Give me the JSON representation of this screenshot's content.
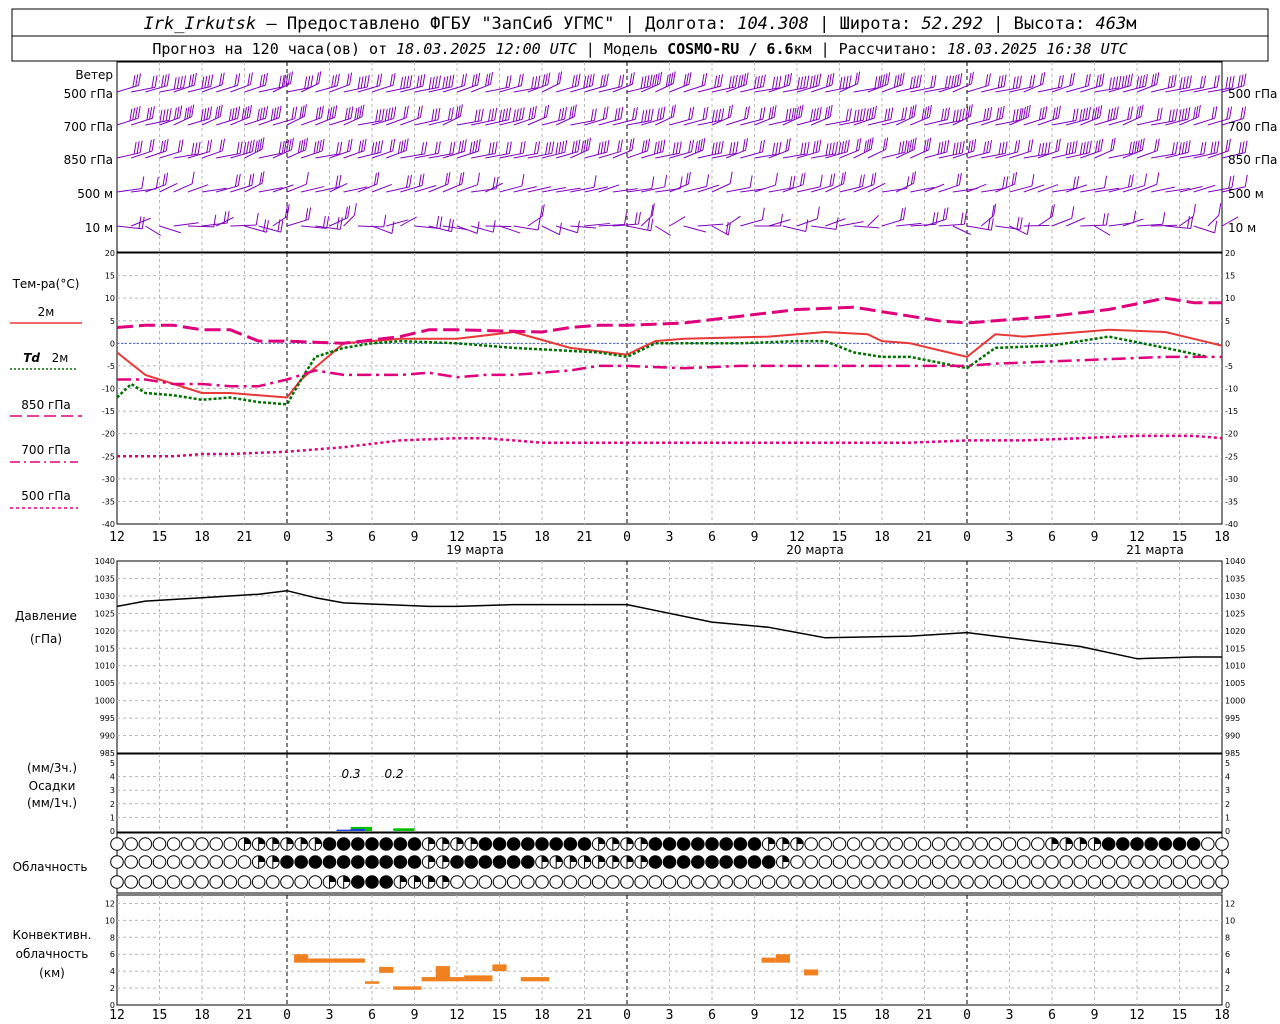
{
  "header": {
    "station": "Irk_Irkutsk",
    "provider": " — Предоставлено ФГБУ \"ЗапСиб УГМС\" | Долгота: ",
    "lon": "104.308",
    "lat_label": " | Широта: ",
    "lat": "52.292",
    "alt_label": " | Высота: ",
    "alt": "463",
    "alt_unit": "м",
    "forecast_label": "Прогноз на 120 часа(ов) от ",
    "forecast_date": "18.03.2025 12:00 UTC",
    "model_label": " | Модель ",
    "model": "COSMO-RU / 6.6",
    "model_unit": "км",
    "calc_label": " | Рассчитано: ",
    "calc_date": "18.03.2025 16:38 UTC"
  },
  "labels": {
    "wind": "Ветер",
    "levels": [
      "500 гПа",
      "700 гПа",
      "850 гПа",
      "500 м",
      "10  м"
    ],
    "temp_title": "Тем-ра(°C)",
    "t2m": "2м",
    "td": "Td",
    "td2": "2м",
    "t850": "850 гПа",
    "t700": "700 гПа",
    "t500": "500 гПа",
    "pressure": "Давление",
    "pressure_unit": "(гПа)",
    "precip_3h": "(мм/3ч.)",
    "precip": "Осадки",
    "precip_1h": "(мм/1ч.)",
    "cloud": "Облачность",
    "conv1": "Конвективн.",
    "conv2": "облачность",
    "conv3": "(км)",
    "days": [
      "19 марта",
      "20 марта",
      "21 марта"
    ],
    "precip_annot": [
      "0.3",
      "0.2"
    ]
  },
  "colors": {
    "wind": "#8000c0",
    "t2m": "#e83838",
    "td": "#007000",
    "t850": "#e0007c",
    "t700": "#e0007c",
    "t500": "#e0007c",
    "pressure": "#000000",
    "precip_3h": "#00c000",
    "precip_1h": "#2040e0",
    "conv": "#f08020"
  },
  "chart_data": {
    "type": "line",
    "x_ticks": [
      "12",
      "15",
      "18",
      "21",
      "0",
      "3",
      "6",
      "9",
      "12",
      "15",
      "18",
      "21",
      "0",
      "3",
      "6",
      "9",
      "12",
      "15",
      "18",
      "21",
      "0",
      "3",
      "6",
      "9",
      "12",
      "15",
      "18"
    ],
    "x_range": [
      0,
      78
    ],
    "day_boundaries": [
      12,
      36,
      60
    ],
    "wind_levels": [
      "500 гПа",
      "700 гПа",
      "850 гПа",
      "500 м",
      "10 м"
    ],
    "temperature": {
      "ylim": [
        -40,
        20
      ],
      "yticks": [
        -40,
        -35,
        -30,
        -25,
        -20,
        -15,
        -10,
        -5,
        0,
        5,
        10,
        15,
        20
      ],
      "series": [
        {
          "name": "2м",
          "x": [
            0,
            2,
            3,
            6,
            8,
            12,
            13,
            16,
            20,
            24,
            28,
            32,
            36,
            38,
            40,
            46,
            50,
            53,
            54,
            56,
            60,
            62,
            64,
            70,
            74,
            76,
            78
          ],
          "values": [
            -2,
            -7,
            -8,
            -11,
            -11,
            -12,
            -8,
            0,
            1,
            1,
            2.5,
            -1,
            -2.5,
            0.5,
            1,
            1.5,
            2.5,
            2,
            0.5,
            0,
            -3,
            2,
            1.5,
            3,
            2.5,
            1,
            -0.5
          ]
        },
        {
          "name": "Td 2м",
          "x": [
            0,
            1,
            2,
            4,
            6,
            8,
            10,
            12,
            13,
            14,
            16,
            18,
            20,
            24,
            28,
            34,
            36,
            38,
            44,
            48,
            50,
            52,
            54,
            56,
            60,
            62,
            66,
            70,
            74,
            77
          ],
          "values": [
            -12,
            -9,
            -11,
            -11.5,
            -12.5,
            -12,
            -13,
            -13.5,
            -8,
            -3,
            -1,
            0,
            0.5,
            0,
            -1,
            -2,
            -3,
            0,
            0,
            0.5,
            0.5,
            -2,
            -3,
            -3,
            -5.5,
            -1,
            -0.5,
            1.5,
            -1,
            -3
          ]
        },
        {
          "name": "850 гПа",
          "x": [
            0,
            2,
            4,
            6,
            8,
            10,
            12,
            16,
            20,
            22,
            24,
            30,
            32,
            34,
            36,
            40,
            44,
            48,
            52,
            56,
            58,
            60,
            62,
            66,
            70,
            74,
            76,
            78
          ],
          "values": [
            3.5,
            4,
            4,
            3,
            3,
            0.5,
            0.5,
            0,
            1.5,
            3,
            3,
            2.5,
            3.5,
            4,
            4,
            4.5,
            6,
            7.5,
            8,
            6,
            5,
            4.5,
            5,
            6,
            7.5,
            10,
            9,
            9
          ]
        },
        {
          "name": "700 гПа",
          "x": [
            0,
            2,
            4,
            6,
            8,
            10,
            12,
            14,
            16,
            18,
            20,
            22,
            24,
            26,
            28,
            30,
            32,
            34,
            36,
            40,
            44,
            48,
            52,
            56,
            58,
            60,
            62,
            66,
            70,
            74,
            78
          ],
          "values": [
            -8,
            -8,
            -9,
            -9,
            -9.5,
            -9.5,
            -8,
            -6,
            -7,
            -7,
            -7,
            -6.5,
            -7.5,
            -7,
            -7,
            -6.5,
            -6,
            -5,
            -5,
            -5.5,
            -5,
            -5,
            -5,
            -5,
            -5,
            -5,
            -4.5,
            -4,
            -3.5,
            -3,
            -3
          ]
        },
        {
          "name": "500 гПа",
          "x": [
            0,
            4,
            6,
            8,
            12,
            16,
            20,
            24,
            26,
            28,
            30,
            32,
            36,
            40,
            44,
            48,
            52,
            56,
            60,
            64,
            68,
            72,
            76,
            78
          ],
          "values": [
            -25,
            -25,
            -24.5,
            -24.5,
            -24,
            -23,
            -21.5,
            -21,
            -21,
            -21.5,
            -22,
            -22,
            -22,
            -22,
            -22,
            -22,
            -22,
            -22,
            -21.5,
            -21.5,
            -21,
            -20.5,
            -20.5,
            -21
          ]
        }
      ]
    },
    "pressure": {
      "ylim": [
        985,
        1040
      ],
      "yticks": [
        985,
        990,
        995,
        1000,
        1005,
        1010,
        1015,
        1020,
        1025,
        1030,
        1035,
        1040
      ],
      "x": [
        0,
        2,
        6,
        10,
        12,
        14,
        16,
        22,
        24,
        28,
        36,
        42,
        46,
        50,
        56,
        60,
        62,
        68,
        72,
        76,
        78
      ],
      "values": [
        1027,
        1028.5,
        1029.5,
        1030.5,
        1031.5,
        1029.5,
        1028,
        1027,
        1027,
        1027.5,
        1027.5,
        1022.5,
        1021,
        1018,
        1018.5,
        1019.5,
        1018.5,
        1015.5,
        1012,
        1012.5,
        1012.5
      ]
    },
    "precipitation": {
      "ylim": [
        0,
        5
      ],
      "yticks": [
        0,
        1,
        2,
        3,
        4,
        5
      ],
      "bars_3h": [
        {
          "x": 18,
          "value": 0.3
        },
        {
          "x": 21,
          "value": 0.2
        }
      ],
      "bars_1h": [
        {
          "x": 16,
          "value": 0.1
        },
        {
          "x": 17,
          "value": 0.15
        }
      ]
    },
    "cloud_cover_rows": 3,
    "convective_cloud": {
      "ylim": [
        0,
        13
      ],
      "yticks": [
        0,
        2,
        4,
        6,
        8,
        10,
        12
      ],
      "segments": [
        {
          "x0": 12.5,
          "x1": 13.5,
          "base": 5,
          "top": 6
        },
        {
          "x0": 13.5,
          "x1": 17.5,
          "base": 5,
          "top": 5.5
        },
        {
          "x0": 17.5,
          "x1": 18.5,
          "base": 2.5,
          "top": 2.8
        },
        {
          "x0": 18.5,
          "x1": 19.5,
          "base": 3.8,
          "top": 4.5
        },
        {
          "x0": 19.5,
          "x1": 21.5,
          "base": 1.8,
          "top": 2.2
        },
        {
          "x0": 21.5,
          "x1": 22.5,
          "base": 2.8,
          "top": 3.3
        },
        {
          "x0": 22.5,
          "x1": 23.5,
          "base": 2.8,
          "top": 4.6
        },
        {
          "x0": 23.5,
          "x1": 24.5,
          "base": 2.8,
          "top": 3.3
        },
        {
          "x0": 24.5,
          "x1": 26.5,
          "base": 2.8,
          "top": 3.5
        },
        {
          "x0": 26.5,
          "x1": 27.5,
          "base": 4,
          "top": 4.8
        },
        {
          "x0": 28.5,
          "x1": 30.5,
          "base": 2.8,
          "top": 3.3
        },
        {
          "x0": 45.5,
          "x1": 46.5,
          "base": 5,
          "top": 5.6
        },
        {
          "x0": 46.5,
          "x1": 47.5,
          "base": 5,
          "top": 6
        },
        {
          "x0": 48.5,
          "x1": 49.5,
          "base": 3.5,
          "top": 4.2
        }
      ]
    }
  }
}
